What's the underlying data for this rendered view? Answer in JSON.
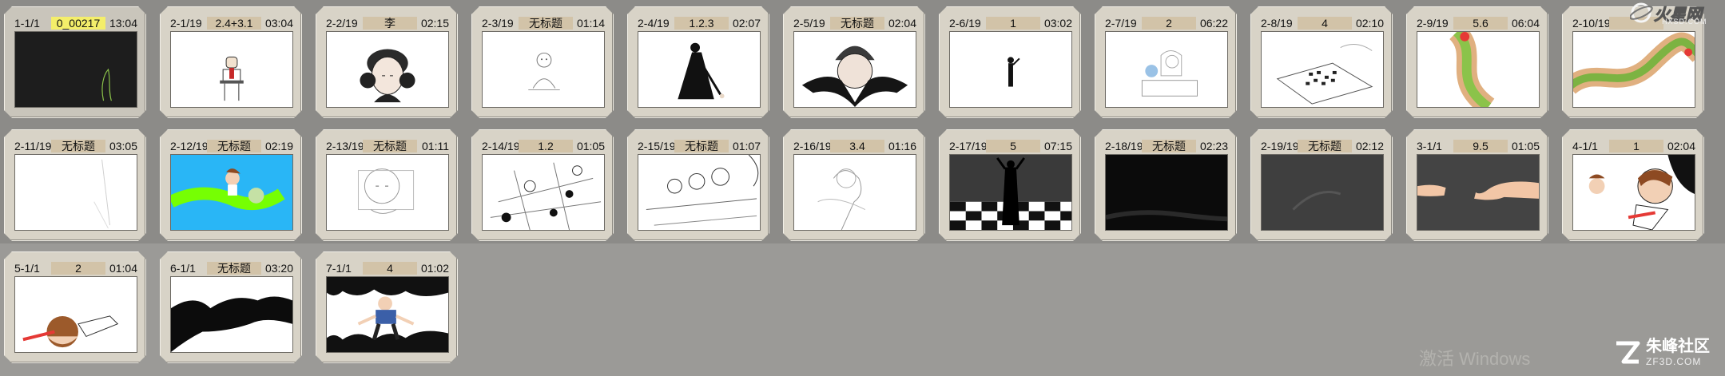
{
  "shots": [
    {
      "id": "1-1/1",
      "name": "0_00217",
      "time": "13:04",
      "selected": true
    },
    {
      "id": "2-1/19",
      "name": "2.4+3.1",
      "time": "03:04"
    },
    {
      "id": "2-2/19",
      "name": "李",
      "time": "02:15"
    },
    {
      "id": "2-3/19",
      "name": "无标题",
      "time": "01:14"
    },
    {
      "id": "2-4/19",
      "name": "1.2.3",
      "time": "02:07"
    },
    {
      "id": "2-5/19",
      "name": "无标题",
      "time": "02:04"
    },
    {
      "id": "2-6/19",
      "name": "1",
      "time": "03:02"
    },
    {
      "id": "2-7/19",
      "name": "2",
      "time": "06:22"
    },
    {
      "id": "2-8/19",
      "name": "4",
      "time": "02:10"
    },
    {
      "id": "2-9/19",
      "name": "5.6",
      "time": "06:04"
    },
    {
      "id": "2-10/19",
      "name": "",
      "time": ""
    },
    {
      "id": "2-11/19",
      "name": "无标题",
      "time": "03:05"
    },
    {
      "id": "2-12/19",
      "name": "无标题",
      "time": "02:19"
    },
    {
      "id": "2-13/19",
      "name": "无标题",
      "time": "01:11"
    },
    {
      "id": "2-14/19",
      "name": "1.2",
      "time": "01:05"
    },
    {
      "id": "2-15/19",
      "name": "无标题",
      "time": "01:07"
    },
    {
      "id": "2-16/19",
      "name": "3.4",
      "time": "01:16"
    },
    {
      "id": "2-17/19",
      "name": "5",
      "time": "07:15"
    },
    {
      "id": "2-18/19",
      "name": "无标题",
      "time": "02:23"
    },
    {
      "id": "2-19/19",
      "name": "无标题",
      "time": "02:12"
    },
    {
      "id": "3-1/1",
      "name": "9.5",
      "time": "01:05"
    },
    {
      "id": "4-1/1",
      "name": "1",
      "time": "02:04"
    },
    {
      "id": "5-1/1",
      "name": "2",
      "time": "01:04"
    },
    {
      "id": "6-1/1",
      "name": "无标题",
      "time": "03:20"
    },
    {
      "id": "7-1/1",
      "name": "4",
      "time": "01:02"
    }
  ],
  "watermarks": {
    "windows": "激活 Windows",
    "site_cn": "朱峰社区",
    "site_en": "ZF3D.COM",
    "top_logo": "火星网",
    "top_logo_sub": "HXSD.COM"
  }
}
